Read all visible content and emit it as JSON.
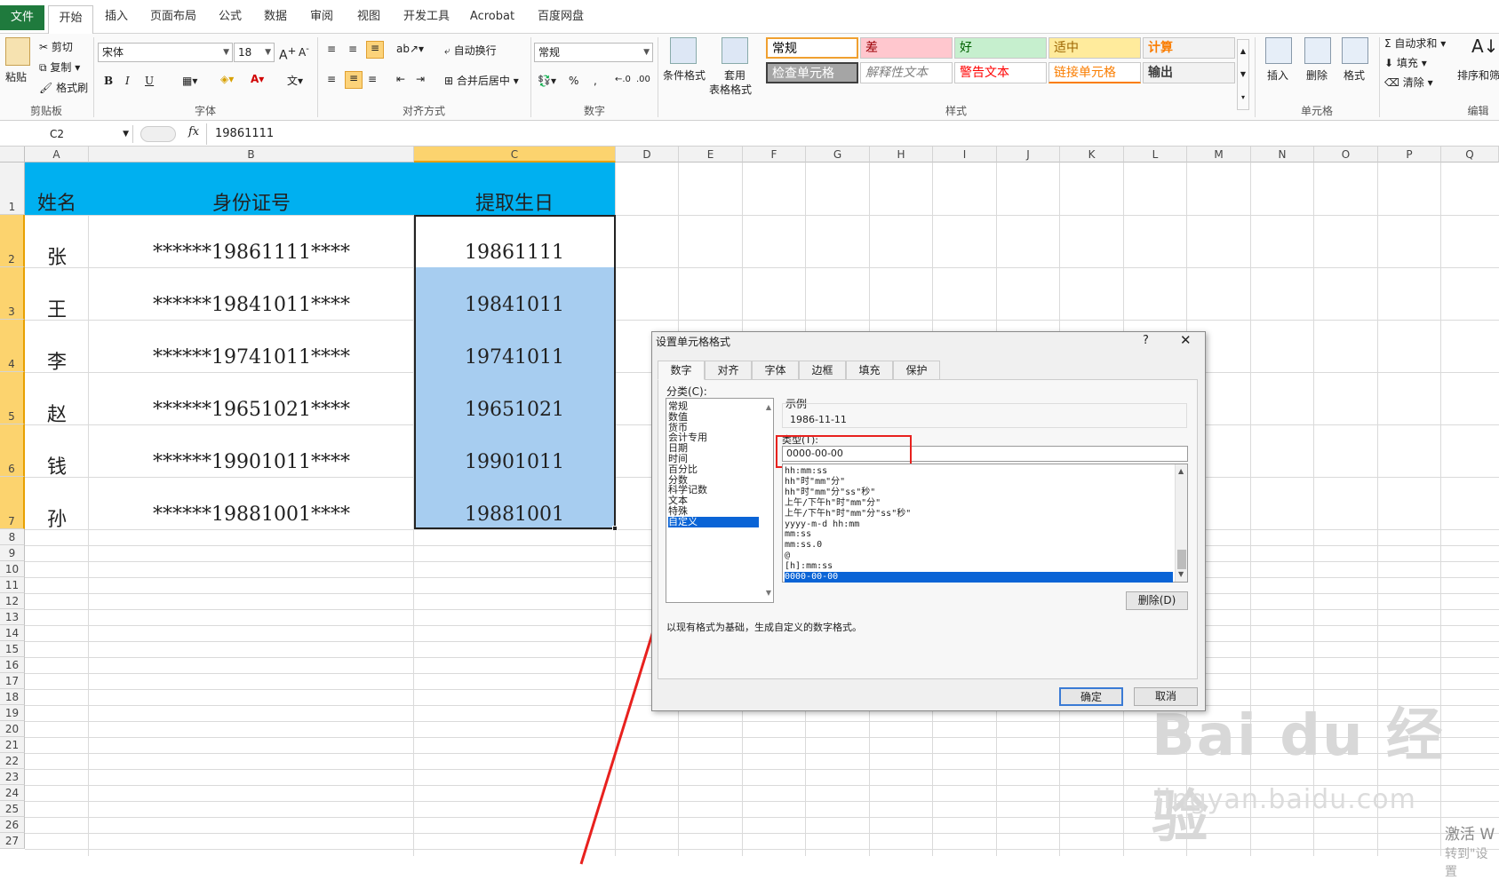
{
  "ribbon_tabs": [
    "文件",
    "开始",
    "插入",
    "页面布局",
    "公式",
    "数据",
    "审阅",
    "视图",
    "开发工具",
    "Acrobat",
    "百度网盘"
  ],
  "clipboard": {
    "paste": "粘贴",
    "cut": "剪切",
    "copy": "复制",
    "format_painter": "格式刷",
    "group": "剪贴板"
  },
  "font": {
    "name": "宋体",
    "size": "18",
    "bold": "B",
    "italic": "I",
    "underline": "U",
    "group": "字体"
  },
  "alignment": {
    "wrap": "自动换行",
    "merge": "合并后居中",
    "group": "对齐方式"
  },
  "number": {
    "format": "常规",
    "group": "数字"
  },
  "styles": {
    "cond": "条件格式",
    "table": "套用",
    "table2": "表格格式",
    "group": "样式",
    "cells": [
      {
        "label": "常规",
        "bg": "#ffffff",
        "color": "#000000"
      },
      {
        "label": "差",
        "bg": "#ffc7ce",
        "color": "#9c0006"
      },
      {
        "label": "好",
        "bg": "#c6efce",
        "color": "#006100"
      },
      {
        "label": "适中",
        "bg": "#ffeb9c",
        "color": "#9c6500"
      },
      {
        "label": "计算",
        "bg": "#f2f2f2",
        "color": "#fa7d00"
      },
      {
        "label": "检查单元格",
        "bg": "#a5a5a5",
        "color": "#ffffff"
      },
      {
        "label": "解释性文本",
        "bg": "#ffffff",
        "color": "#7f7f7f"
      },
      {
        "label": "警告文本",
        "bg": "#ffffff",
        "color": "#ff0000"
      },
      {
        "label": "链接单元格",
        "bg": "#ffffff",
        "color": "#fa7d00"
      },
      {
        "label": "输出",
        "bg": "#f2f2f2",
        "color": "#3f3f3f"
      }
    ]
  },
  "cells_group": {
    "insert": "插入",
    "delete": "删除",
    "format": "格式",
    "group": "单元格"
  },
  "editing": {
    "autosum": "自动求和",
    "fill": "填充",
    "clear": "清除",
    "sort": "排序和筛",
    "group": "编辑"
  },
  "formula_bar": {
    "name_box": "C2",
    "fx": "fx",
    "value": "19861111"
  },
  "columns": [
    "A",
    "B",
    "C",
    "D",
    "E",
    "F",
    "G",
    "H",
    "I",
    "J",
    "K",
    "L",
    "M",
    "N",
    "O",
    "P",
    "Q"
  ],
  "headers": [
    "姓名",
    "身份证号",
    "提取生日"
  ],
  "rows": [
    {
      "name": "张",
      "id": "******19861111****",
      "birth": "19861111"
    },
    {
      "name": "王",
      "id": "******19841011****",
      "birth": "19841011"
    },
    {
      "name": "李",
      "id": "******19741011****",
      "birth": "19741011"
    },
    {
      "name": "赵",
      "id": "******19651021****",
      "birth": "19651021"
    },
    {
      "name": "钱",
      "id": "******19901011****",
      "birth": "19901011"
    },
    {
      "name": "孙",
      "id": "******19881001****",
      "birth": "19881001"
    }
  ],
  "row_numbers": [
    "1",
    "2",
    "3",
    "4",
    "5",
    "6",
    "7",
    "8",
    "9",
    "10",
    "11",
    "12",
    "13",
    "14",
    "15",
    "16",
    "17",
    "18",
    "19",
    "20",
    "21",
    "22",
    "23",
    "24",
    "25",
    "26",
    "27"
  ],
  "dialog": {
    "title": "设置单元格格式",
    "help": "?",
    "close": "✕",
    "tabs": [
      "数字",
      "对齐",
      "字体",
      "边框",
      "填充",
      "保护"
    ],
    "category_label": "分类(C):",
    "categories": [
      "常规",
      "数值",
      "货币",
      "会计专用",
      "日期",
      "时间",
      "百分比",
      "分数",
      "科学记数",
      "文本",
      "特殊",
      "自定义"
    ],
    "sample_label": "示例",
    "sample_value": "1986-11-11",
    "type_label": "类型(T):",
    "type_value": "0000-00-00",
    "formats": [
      "hh:mm:ss",
      "hh\"时\"mm\"分\"",
      "hh\"时\"mm\"分\"ss\"秒\"",
      "上午/下午h\"时\"mm\"分\"",
      "上午/下午h\"时\"mm\"分\"ss\"秒\"",
      "yyyy-m-d hh:mm",
      "mm:ss",
      "mm:ss.0",
      "@",
      "[h]:mm:ss",
      "0000-00-00"
    ],
    "delete": "删除(D)",
    "description": "以现有格式为基础，生成自定义的数字格式。",
    "ok": "确定",
    "cancel": "取消"
  },
  "watermark": {
    "brand": "Bai du 经验",
    "url": "jingyan.baidu.com",
    "activate": "激活 W",
    "activate2": "转到\"设置"
  },
  "colors": {
    "header_fill": "#00b0f0",
    "selection_fill": "#a7cdf0",
    "highlight_red": "#e8211e",
    "ribbon_green": "#1f7a3d"
  }
}
